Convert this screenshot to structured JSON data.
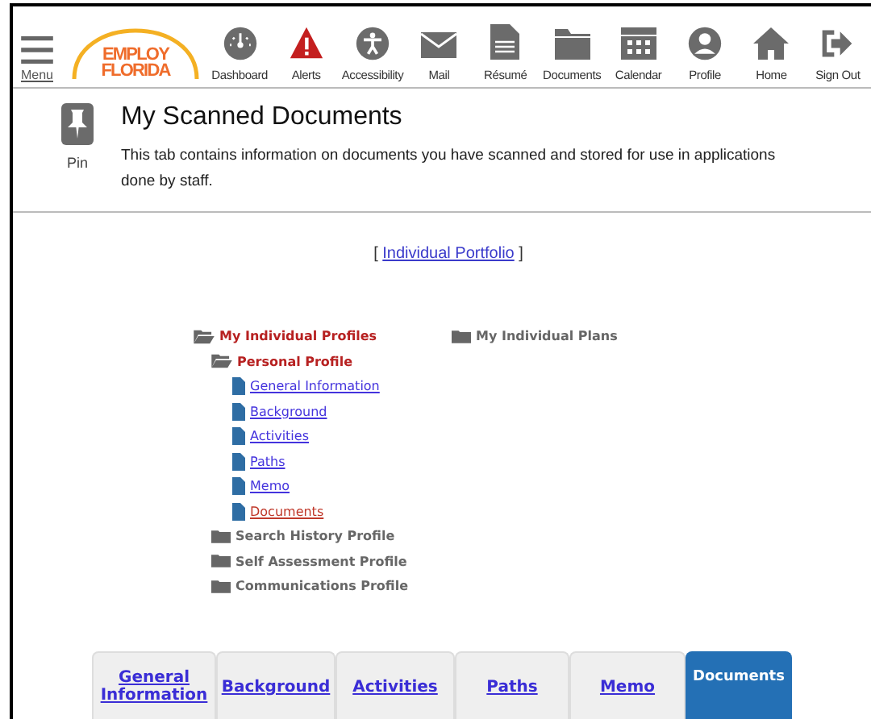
{
  "menu": {
    "label": "Menu"
  },
  "logo": {
    "line1": "EMPLOY",
    "line2": "FLORIDA"
  },
  "nav": [
    {
      "label": "Dashboard"
    },
    {
      "label": "Alerts"
    },
    {
      "label": "Accessibility"
    },
    {
      "label": "Mail"
    },
    {
      "label": "Résumé"
    },
    {
      "label": "Documents"
    },
    {
      "label": "Calendar"
    },
    {
      "label": "Profile"
    },
    {
      "label": "Home"
    },
    {
      "label": "Sign Out"
    }
  ],
  "header": {
    "pin_label": "Pin",
    "title": "My Scanned Documents",
    "description": "This tab contains information on documents you have scanned and stored for use in applications done by staff."
  },
  "portfolio_link": {
    "open": "[",
    "label": "Individual Portfolio",
    "close": "]"
  },
  "tree": [
    {
      "kind": "folder",
      "label": "My Individual Profiles",
      "expanded": true,
      "children": [
        {
          "kind": "folder",
          "label": "Personal Profile",
          "expanded": true,
          "children": [
            {
              "kind": "document",
              "label": "General Information",
              "selected": false
            },
            {
              "kind": "document",
              "label": "Background",
              "selected": false
            },
            {
              "kind": "document",
              "label": "Activities",
              "selected": false
            },
            {
              "kind": "document",
              "label": "Paths",
              "selected": false
            },
            {
              "kind": "document",
              "label": "Memo",
              "selected": false
            },
            {
              "kind": "document",
              "label": "Documents",
              "selected": true
            }
          ]
        },
        {
          "kind": "folder",
          "label": "Search History Profile",
          "expanded": false
        },
        {
          "kind": "folder",
          "label": "Self Assessment Profile",
          "expanded": false
        },
        {
          "kind": "folder",
          "label": "Communications Profile",
          "expanded": false
        }
      ]
    }
  ],
  "tree_right": [
    {
      "kind": "folder",
      "label": "My Individual Plans",
      "expanded": false
    }
  ],
  "tabs": [
    {
      "label": "General Information",
      "selected": false
    },
    {
      "label": "Background",
      "selected": false
    },
    {
      "label": "Activities",
      "selected": false
    },
    {
      "label": "Paths",
      "selected": false
    },
    {
      "label": "Memo",
      "selected": false
    },
    {
      "label": "Documents",
      "selected": true
    }
  ]
}
